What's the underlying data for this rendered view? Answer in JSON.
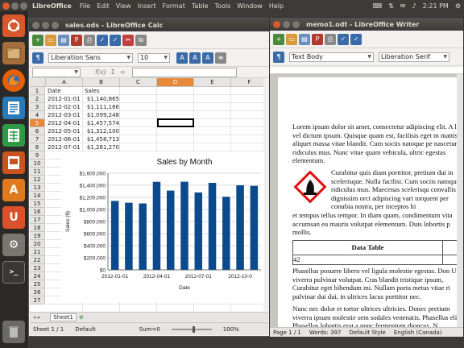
{
  "topbar": {
    "app_name": "LibreOffice",
    "menus": [
      "File",
      "Edit",
      "View",
      "Insert",
      "Format",
      "Table",
      "Tools",
      "Window",
      "Help"
    ],
    "time": "2:21 PM"
  },
  "launcher": {
    "items": [
      {
        "name": "dash-home-icon",
        "color": "#d8572c"
      },
      {
        "name": "files-icon",
        "color": "#a56d3a"
      },
      {
        "name": "firefox-icon",
        "color": "#e66000"
      },
      {
        "name": "writer-icon",
        "color": "#2a7ab8"
      },
      {
        "name": "calc-icon",
        "color": "#2f9a45"
      },
      {
        "name": "impress-icon",
        "color": "#c9541f"
      },
      {
        "name": "software-center-icon",
        "color": "#e07a1f"
      },
      {
        "name": "ubuntu-one-icon",
        "color": "#d9522b"
      },
      {
        "name": "system-settings-icon",
        "color": "#7a7670"
      },
      {
        "name": "terminal-icon",
        "color": "#3a3835"
      },
      {
        "name": "trash-icon",
        "color": "#6b6a66"
      }
    ]
  },
  "calc": {
    "title": "sales.ods - LibreOffice Calc",
    "font_name": "Liberation Sans",
    "font_size": "10",
    "name_box": "",
    "formula_icon": "f(x)",
    "sum_icon": "Σ",
    "eq_icon": "=",
    "columns": [
      "A",
      "B",
      "C",
      "D",
      "E",
      "F"
    ],
    "rows": [
      "1",
      "2",
      "3",
      "4",
      "5",
      "6",
      "7",
      "8",
      "9",
      "10",
      "11",
      "12",
      "13",
      "14",
      "15",
      "16",
      "17",
      "18",
      "19",
      "20",
      "21",
      "22",
      "23",
      "24",
      "25",
      "26",
      "27"
    ],
    "selected_row": "5",
    "selected_col": "D",
    "cells": [
      {
        "a": "Date",
        "b": "Sales"
      },
      {
        "a": "2012-01-01",
        "b": "$1,140,865"
      },
      {
        "a": "2012-02-01",
        "b": "$1,111,166"
      },
      {
        "a": "2012-03-01",
        "b": "$1,099,248"
      },
      {
        "a": "2012-04-01",
        "b": "$1,457,574"
      },
      {
        "a": "2012-05-01",
        "b": "$1,312,100"
      },
      {
        "a": "2012-06-01",
        "b": "$1,458,713"
      },
      {
        "a": "2012-07-01",
        "b": "$1,281,270"
      }
    ],
    "sheet_tab": "Sheet1",
    "status": {
      "sheet": "Sheet 1 / 1",
      "style": "Default",
      "sum": "Sum=0",
      "zoom": "100%"
    }
  },
  "chart_data": {
    "type": "bar",
    "title": "Sales by Month",
    "xlabel": "Date",
    "ylabel": "Sales ($)",
    "ylim": [
      0,
      1600000
    ],
    "yticks": [
      "$0",
      "$200,000",
      "$400,000",
      "$600,000",
      "$800,000",
      "$1,000,000",
      "$1,200,000",
      "$1,400,000",
      "$1,600,000"
    ],
    "xticks": [
      "2012-01-01",
      "2012-04-01",
      "2012-07-01",
      "2012-10-0"
    ],
    "values": [
      1140865,
      1111166,
      1099248,
      1457574,
      1312100,
      1458713,
      1281270,
      1440000,
      1210000,
      1400000,
      1390000
    ],
    "bar_color": "#0b4a8c",
    "grid": true
  },
  "writer": {
    "title": "memo1.odt - LibreOffice Writer",
    "para_style": "Text Body",
    "font_name": "Liberation Serif",
    "para1": "Lorem ipsum dolor sit amet, consectetur adipiscing elit. A leo, vel dictum ipsum. Quisque quam est, facilisis eget m mattis aliquet massa vitae blandit. Cum sociis natoque pe nascetur ridiculus mus. Nunc vitae quam vehicula, ultric egestas elementum.",
    "para2a": "Curabitur quis diam porttitor, pretium dui in scelerisque. Nulla facilisi. Cum sociis natoque p ridiculus mus. Maecenas scelerisqu convallis leo dignissim orci adipiscing vari torquent per conubia nostra, per inceptos hi",
    "para2b": "et tempus tellus tempor. In diam quam, condimentum vita accumsan eu mauris volutpat elementum. Duis lobortis p mollis.",
    "table_header": "Data Table",
    "table_value": "42",
    "para3": "Phasellus posuere libero vel ligula molestie egestas. Don Ut viverra pulvinar volutpat. Cras blandit tristique ipsum, Curabitur eget bibendum mi. Nullam porta metus vitae ri pulvinar dui dui, in ultrices lacus porttitor nec.",
    "para4": "Nunc nec dolor et tortor ultrices ultricies. Donec pretium viverra ipsum molestie sem sodales venenatis. Phasellus elit. Phasellus lobortis erat a nunc fermentum rhoncus. N",
    "status": {
      "page": "Page 1 / 1",
      "words": "Words: 397",
      "style": "Default Style",
      "lang": "English (Canada)"
    }
  }
}
